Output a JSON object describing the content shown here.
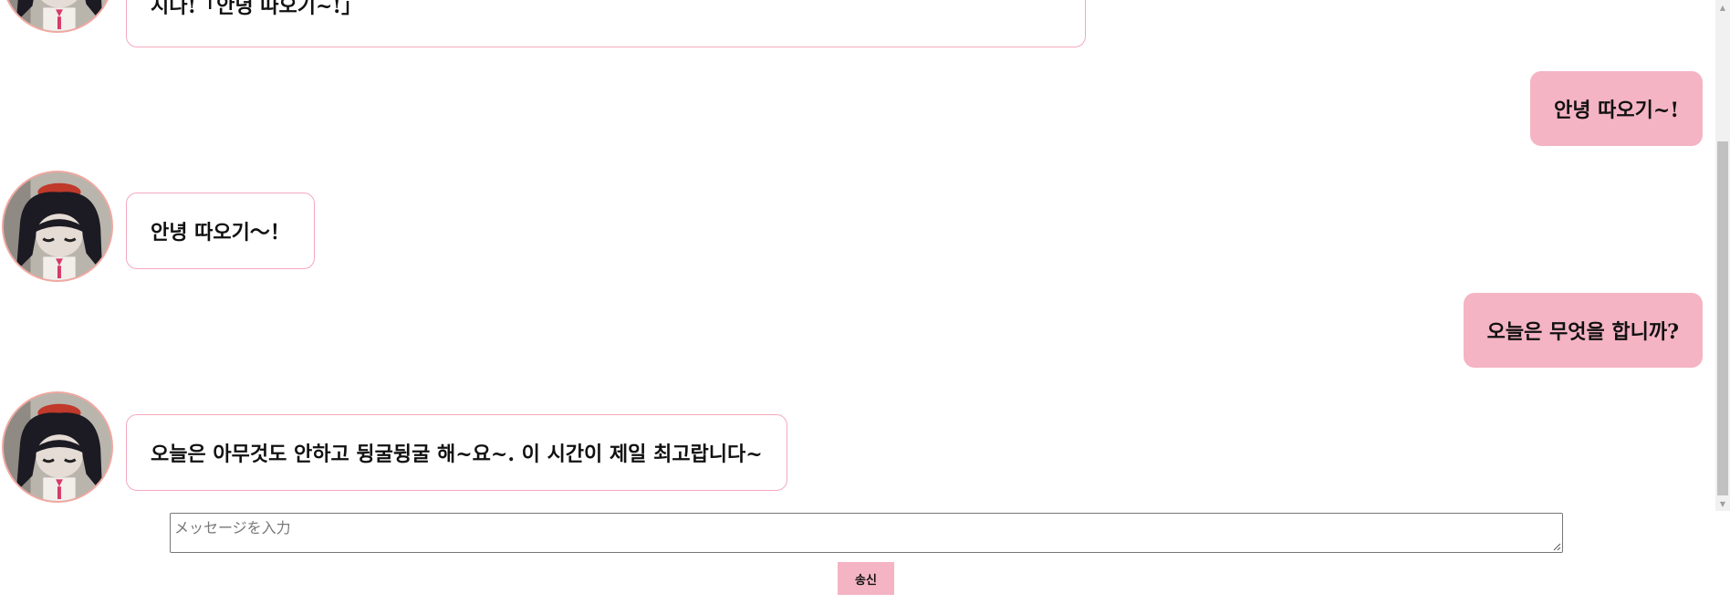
{
  "messages": [
    {
      "role": "bot",
      "text": "시다!「안녕 따오기~!」"
    },
    {
      "role": "user",
      "text": "안녕 따오기~!"
    },
    {
      "role": "bot",
      "text": "안녕 따오기～！"
    },
    {
      "role": "user",
      "text": "오늘은 무엇을 합니까?"
    },
    {
      "role": "bot",
      "text": "오늘은 아무것도 안하고 뒹굴뒹굴 해~요~. 이 시간이 제일 최고랍니다~"
    }
  ],
  "composer": {
    "placeholder": "メッセージを入力",
    "value": "",
    "send_label": "송신"
  },
  "avatar": {
    "icon": "character-avatar-icon",
    "border_color": "#f0a8a0"
  },
  "colors": {
    "user_bubble": "#f4b4c4",
    "bot_border": "#f4a9bd",
    "send_button": "#f4b4c4"
  },
  "scrollbar": {
    "up_icon": "scroll-up-arrow-icon",
    "down_icon": "scroll-down-arrow-icon"
  }
}
